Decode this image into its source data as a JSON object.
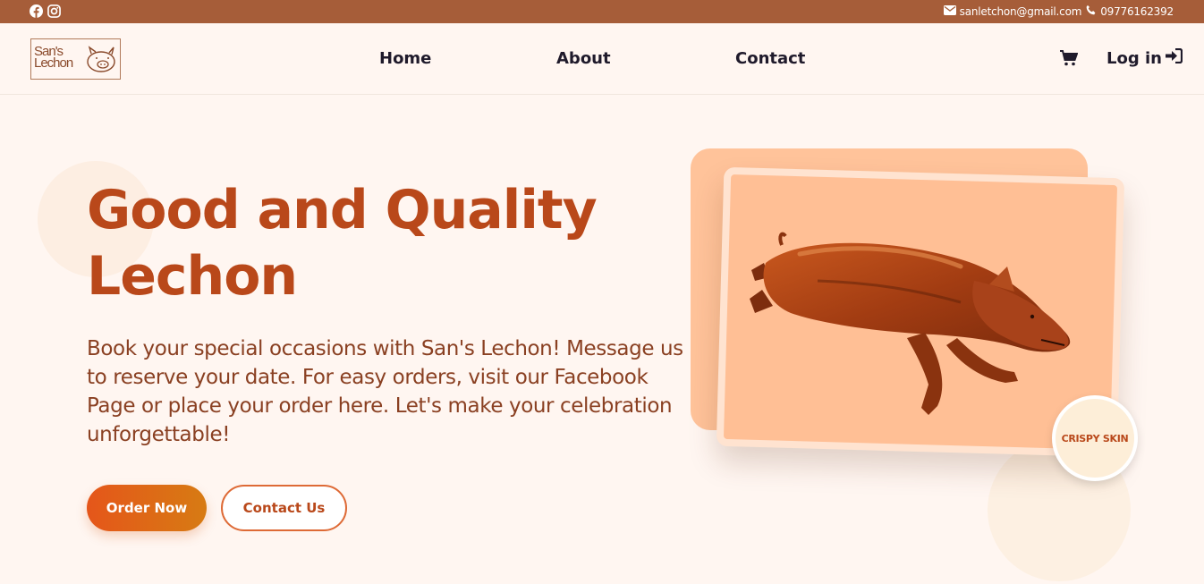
{
  "topbar": {
    "icons": [
      "facebook-icon",
      "instagram-icon"
    ],
    "email": "sanletchon@gmail.com",
    "phone": "09776162392",
    "color": "#a65d39"
  },
  "header": {
    "logo_text": "San's Lechon",
    "nav": [
      "Home",
      "About",
      "Contact"
    ],
    "login_label": "Log in",
    "icons": [
      "cart-icon",
      "login-arrow-icon"
    ]
  },
  "hero": {
    "title_line1": "Good and Quality",
    "title_line2": "Lechon",
    "description": "Book your special occasions with San's Lechon! Message us to reserve your date. For easy orders, visit our Facebook Page or place your order here. Let's make your celebration unforgettable!",
    "order_button": "Order Now",
    "contact_button": "Contact Us",
    "badge": "CRISPY SKIN",
    "accent_color": "#b9481a"
  }
}
